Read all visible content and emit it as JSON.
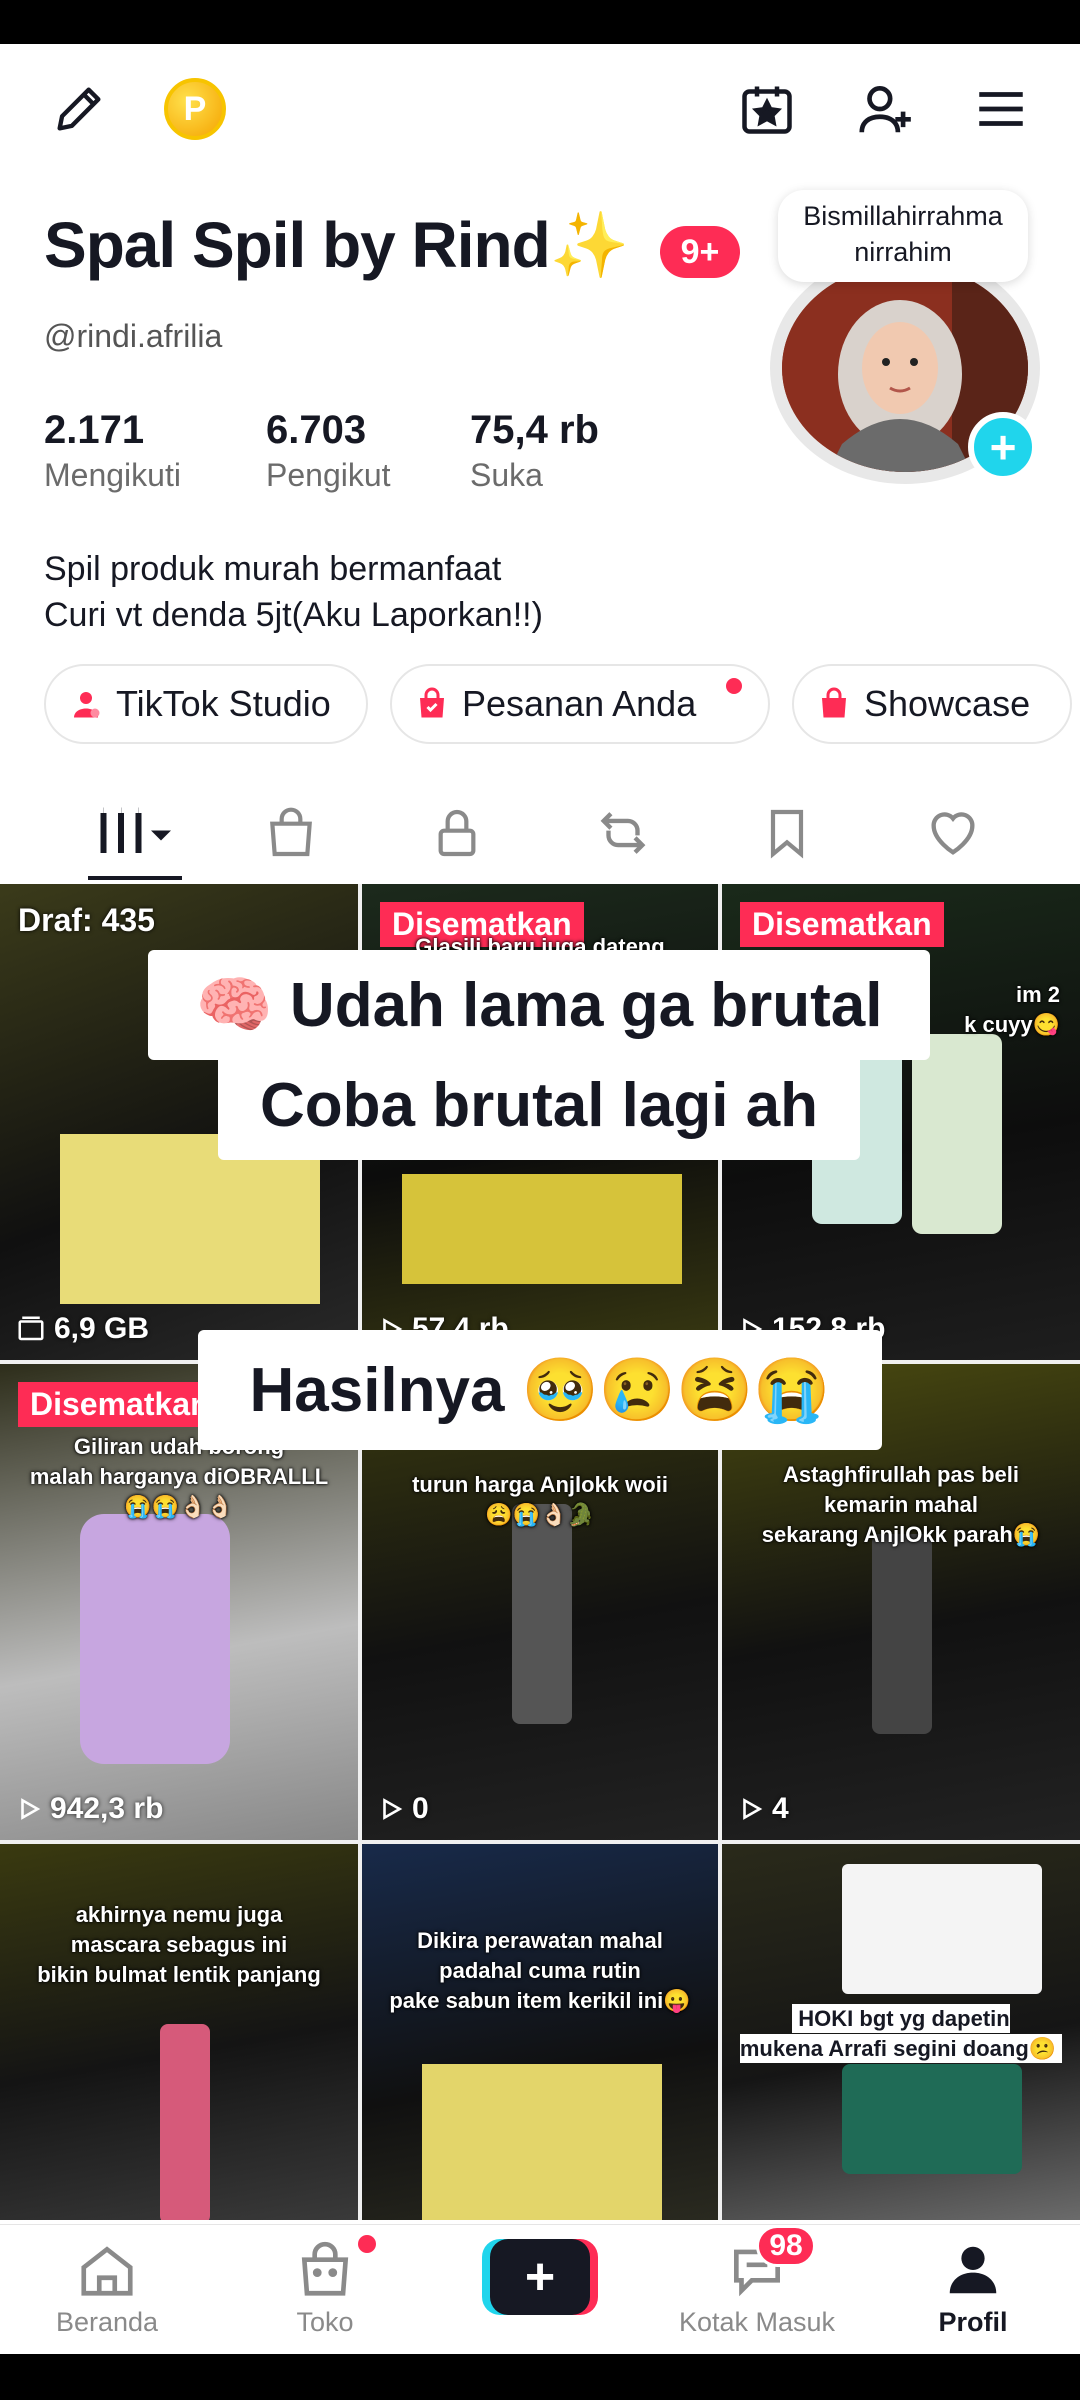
{
  "profile": {
    "name": "Spal Spil by Rind✨",
    "notification_count": "9+",
    "handle": "@rindi.afrilia",
    "story_bubble": "Bismillahirrahma nirrahim",
    "stats": [
      {
        "value": "2.171",
        "label": "Mengikuti"
      },
      {
        "value": "6.703",
        "label": "Pengikut"
      },
      {
        "value": "75,4 rb",
        "label": "Suka"
      }
    ],
    "bio": "Spil produk murah bermanfaat\nCuri vt denda 5jt(Aku Laporkan!!)",
    "buttons": {
      "studio": "TikTok Studio",
      "orders": "Pesanan Anda",
      "showcase": "Showcase"
    },
    "coin_letter": "P"
  },
  "grid": {
    "draft_label": "Draf: 435",
    "draft_size": "6,9 GB",
    "pinned_label": "Disematkan",
    "tiles": [
      {
        "caption": "",
        "views": "6,9 GB"
      },
      {
        "caption": "Glasili baru juga dateng",
        "views": "57,4 rb"
      },
      {
        "caption": "im 2\nk cuyy😋",
        "views": "152,8 rb"
      },
      {
        "caption": "Giliran udah borong\nmalah harganya diOBRALLL\n😭😭👌🏻👌🏻",
        "views": "942,3 rb"
      },
      {
        "caption": "turun harga Anjlokk woii\n😩😭👌🏻🐊",
        "views": "0"
      },
      {
        "caption": "Astaghfirullah pas beli\nkemarin mahal\nsekarang AnjlOkk parah😭",
        "views": "4"
      },
      {
        "caption": "akhirnya nemu juga\nmascara sebagus ini\nbikin bulmat lentik panjang",
        "views": ""
      },
      {
        "caption": "Dikira perawatan mahal\npadahal cuma rutin\npake sabun item kerikil ini😛",
        "views": ""
      },
      {
        "caption": "HOKI bgt yg dapetin\nmukena Arrafi segini doang😕",
        "views": ""
      }
    ]
  },
  "overlay": {
    "line1": "🧠 Udah lama ga brutal",
    "line2": "Coba brutal lagi ah",
    "line3": "Hasilnya 🥹😢😫😭"
  },
  "nav": {
    "home": "Beranda",
    "shop": "Toko",
    "inbox": "Kotak Masuk",
    "inbox_badge": "98",
    "profile": "Profil"
  },
  "colors": {
    "accent": "#fe2c55",
    "cyan": "#20d5ec",
    "text": "#161823"
  }
}
